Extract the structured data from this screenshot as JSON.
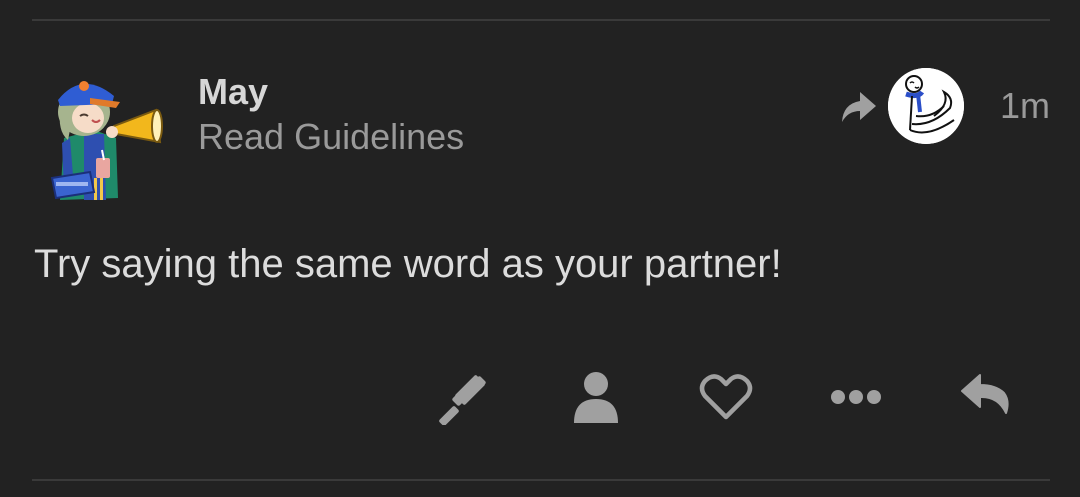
{
  "post": {
    "author": "May",
    "category": "Read Guidelines",
    "date": "1m",
    "body": "Try saying the same word as your partner!"
  },
  "icons": {
    "reply_to": "share-arrow-icon",
    "reply_to_avatar": "user-avatar",
    "admin": "gavel-icon",
    "assign": "user-icon",
    "like": "heart-icon",
    "more": "ellipsis-icon",
    "reply": "reply-icon"
  },
  "colors": {
    "background": "#222222",
    "text": "#dcdcdc",
    "muted": "#9a9a9a",
    "icon": "#a0a0a0",
    "divider": "#3a3a3a"
  }
}
